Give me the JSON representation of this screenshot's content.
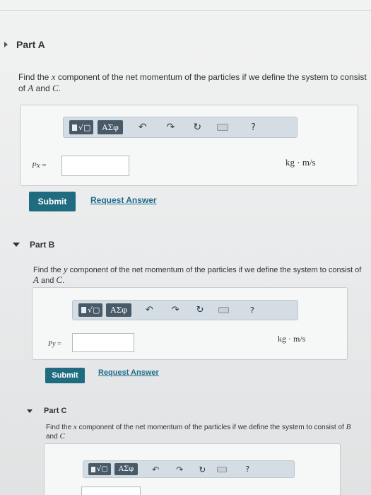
{
  "parts": [
    {
      "title": "Part A",
      "question": {
        "pre": "Find the ",
        "var": "x",
        "mid": " component of the net momentum of the particles if we define the system to consist of ",
        "a": "A",
        "and": " and ",
        "b": "C",
        "end": "."
      },
      "toolbar": {
        "greek": "ΑΣφ",
        "help": "?"
      },
      "variable": "Px",
      "equals": "=",
      "input_value": "",
      "units": "kg · m/s",
      "submit_label": "Submit",
      "request_label": "Request Answer"
    },
    {
      "title": "Part B",
      "question": {
        "pre": "Find the ",
        "var": "y",
        "mid": " component of the net momentum of the particles if we define the system to consist of ",
        "a": "A",
        "and": " and ",
        "b": "C",
        "end": "."
      },
      "toolbar": {
        "greek": "ΑΣφ",
        "help": "?"
      },
      "variable": "Py",
      "equals": "=",
      "input_value": "",
      "units": "kg · m/s",
      "submit_label": "Submit",
      "request_label": "Request Answer"
    },
    {
      "title": "Part C",
      "question": {
        "pre": "Find the ",
        "var": "x",
        "mid": " component of the net momentum of the particles if we define the system to consist of ",
        "a": "B",
        "and": " and ",
        "b": "C",
        "end": ""
      },
      "toolbar": {
        "greek": "ΑΣφ",
        "help": "?"
      }
    }
  ],
  "icons": {
    "templates": "templates-icon",
    "greek": "greek-letters-icon",
    "undo": "undo-icon",
    "redo": "redo-icon",
    "reset": "reset-icon",
    "keyboard": "keyboard-icon",
    "help": "help-icon"
  }
}
